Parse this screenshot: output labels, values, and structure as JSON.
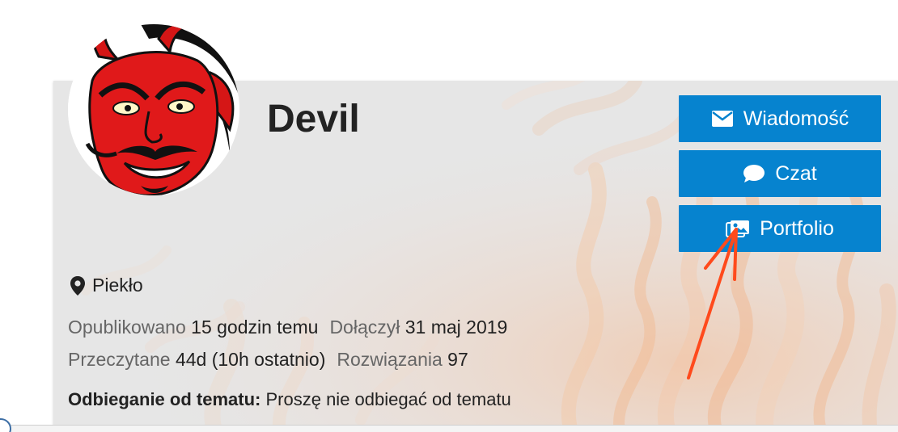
{
  "profile": {
    "username": "Devil",
    "location": "Piekło"
  },
  "actions": {
    "message_label": "Wiadomość",
    "chat_label": "Czat",
    "portfolio_label": "Portfolio"
  },
  "stats": {
    "published_label": "Opublikowano",
    "published_value": "15 godzin temu",
    "joined_label": "Dołączył",
    "joined_value": "31 maj 2019",
    "read_label": "Przeczytane",
    "read_value": "44d (10h ostatnio)",
    "solutions_label": "Rozwiązania",
    "solutions_value": "97"
  },
  "offtopic": {
    "label": "Odbieganie od tematu:",
    "value": "Proszę nie odbiegać od tematu"
  },
  "colors": {
    "button": "#0683cf",
    "annotation_arrow": "#ff4a1c",
    "devil_red": "#e0191a"
  },
  "icons": {
    "message": "envelope-icon",
    "chat": "chat-bubble-icon",
    "portfolio": "portfolio-image-icon",
    "location": "map-pin-icon"
  }
}
